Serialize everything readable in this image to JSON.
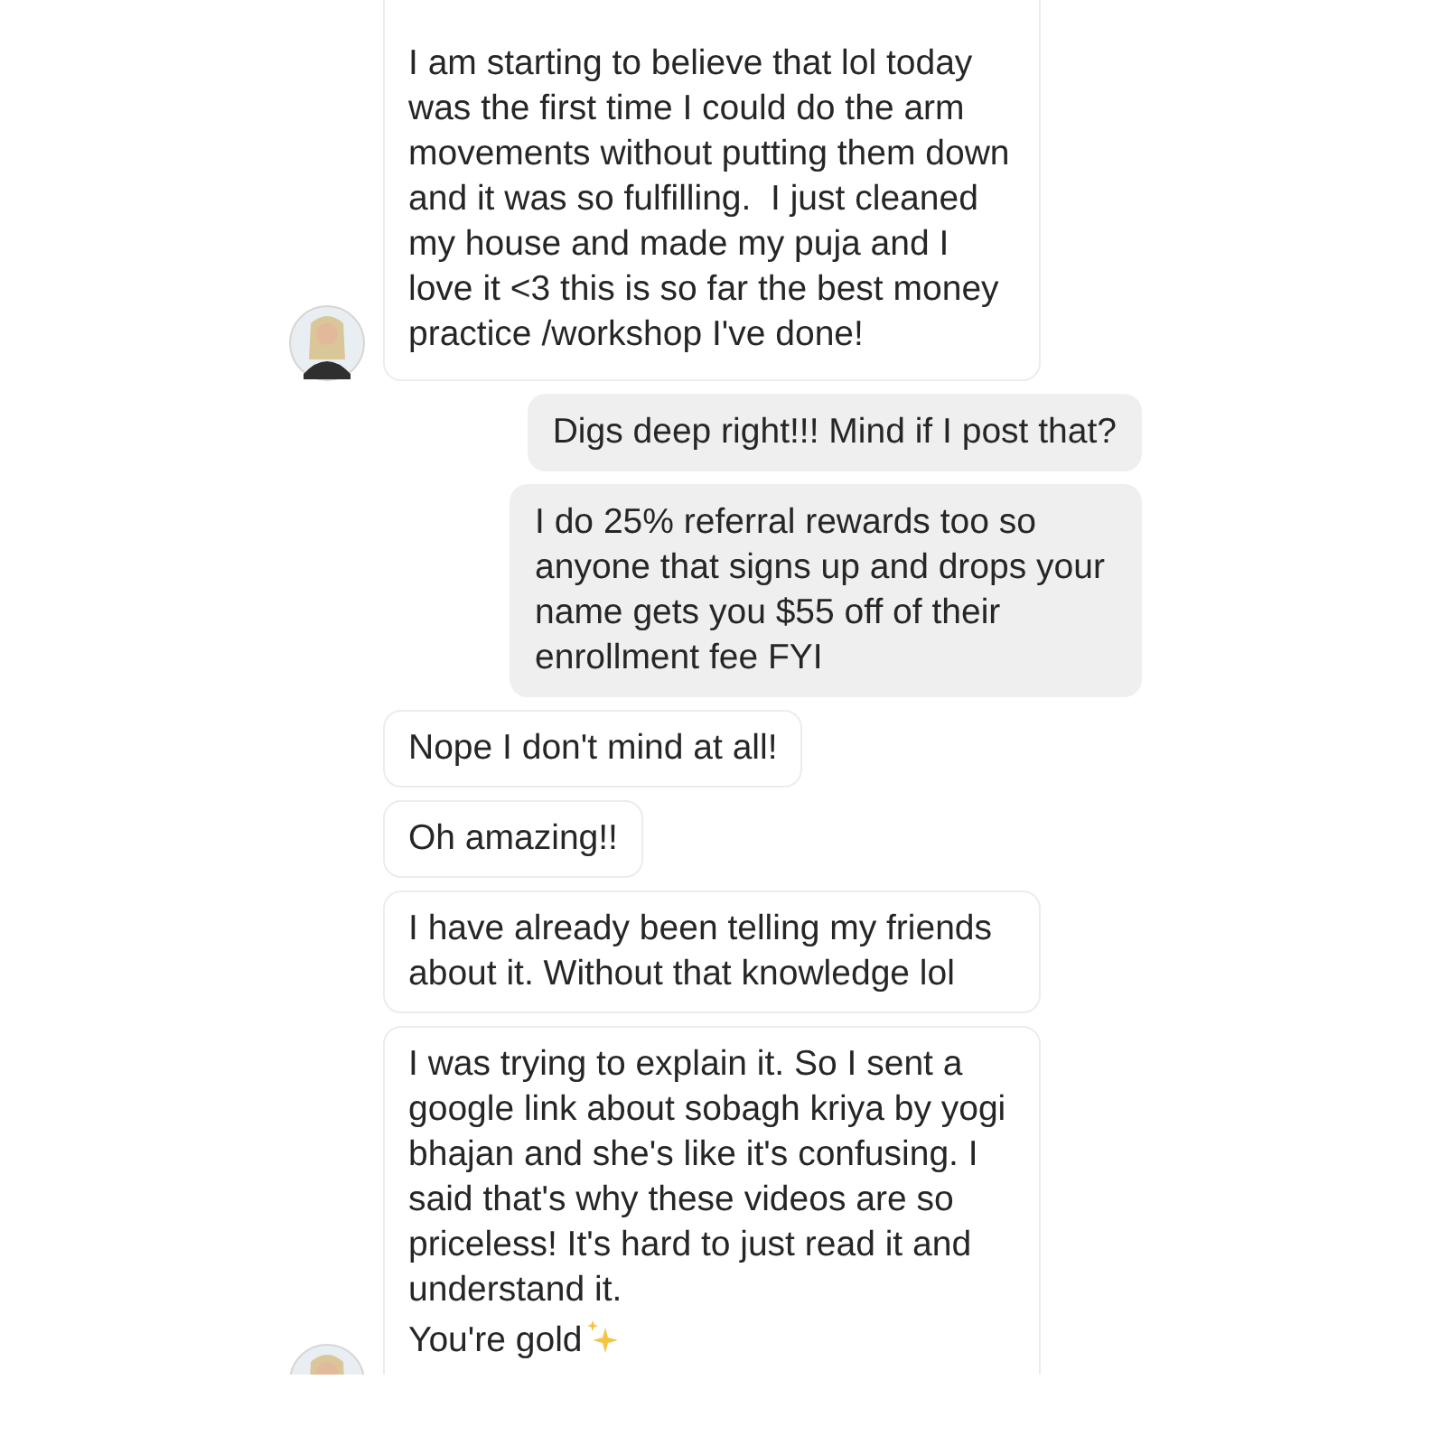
{
  "messages": [
    {
      "kind": "incoming",
      "avatar": true,
      "paragraphs": [
        "I am starting to believe that lol today was the first time I could do the arm movements without putting them down and it was so fulfilling.  I just cleaned my house and made my puja and I love it <3 this is so far the best money practice /workshop I've done!"
      ]
    },
    {
      "kind": "outgoing",
      "avatar": false,
      "paragraphs": [
        "Digs deep right!!! Mind if I post that?"
      ]
    },
    {
      "kind": "outgoing",
      "avatar": false,
      "paragraphs": [
        "I do 25% referral rewards too so anyone that signs up and drops your name gets you $55 off of their enrollment fee FYI"
      ]
    },
    {
      "kind": "incoming",
      "avatar": false,
      "paragraphs": [
        "Nope I don't mind at all!"
      ]
    },
    {
      "kind": "incoming",
      "avatar": false,
      "paragraphs": [
        "Oh amazing!!"
      ]
    },
    {
      "kind": "incoming",
      "avatar": false,
      "paragraphs": [
        "I have already been telling my friends about it. Without that knowledge lol"
      ]
    },
    {
      "kind": "incoming",
      "avatar": true,
      "paragraphs": [
        "I was trying to explain it. So I sent a google link about sobagh kriya by yogi bhajan and she's like it's confusing. I said that's why these videos are so priceless! It's hard to just read it and understand it.",
        "You're gold"
      ],
      "sparkles": true
    }
  ]
}
